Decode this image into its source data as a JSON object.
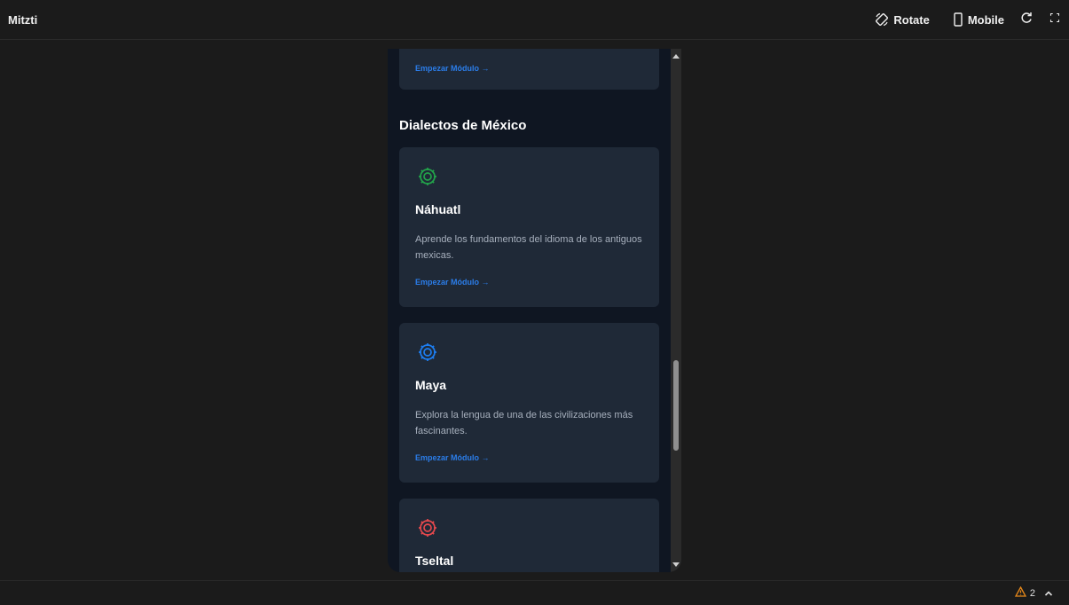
{
  "app": {
    "title": "Mitzti"
  },
  "toolbar": {
    "rotate_label": "Rotate",
    "mobile_label": "Mobile",
    "icons": [
      "rotate-icon",
      "mobile-icon",
      "reload-icon",
      "fullscreen-icon"
    ]
  },
  "preview": {
    "top_card": {
      "link": "Empezar Módulo →"
    },
    "section_title": "Dialectos de México",
    "cards": [
      {
        "title": "Náhuatl",
        "description": "Aprende los fundamentos del idioma de los antiguos mexicas.",
        "link": "Empezar Módulo →",
        "icon": "gear-icon",
        "icon_color": "#22a34a"
      },
      {
        "title": "Maya",
        "description": "Explora la lengua de una de las civilizaciones más fascinantes.",
        "link": "Empezar Módulo →",
        "icon": "gear-icon",
        "icon_color": "#1d7ef2"
      },
      {
        "title": "Tseltal",
        "description": "",
        "link": "",
        "icon": "gear-icon",
        "icon_color": "#e5484d"
      }
    ]
  },
  "statusbar": {
    "warning_count": "2",
    "warning_color": "#e8891a"
  },
  "colors": {
    "background": "#1b1b1b",
    "device_bg": "#0f1622",
    "card_bg": "#1f2937",
    "link": "#2b7de9"
  }
}
